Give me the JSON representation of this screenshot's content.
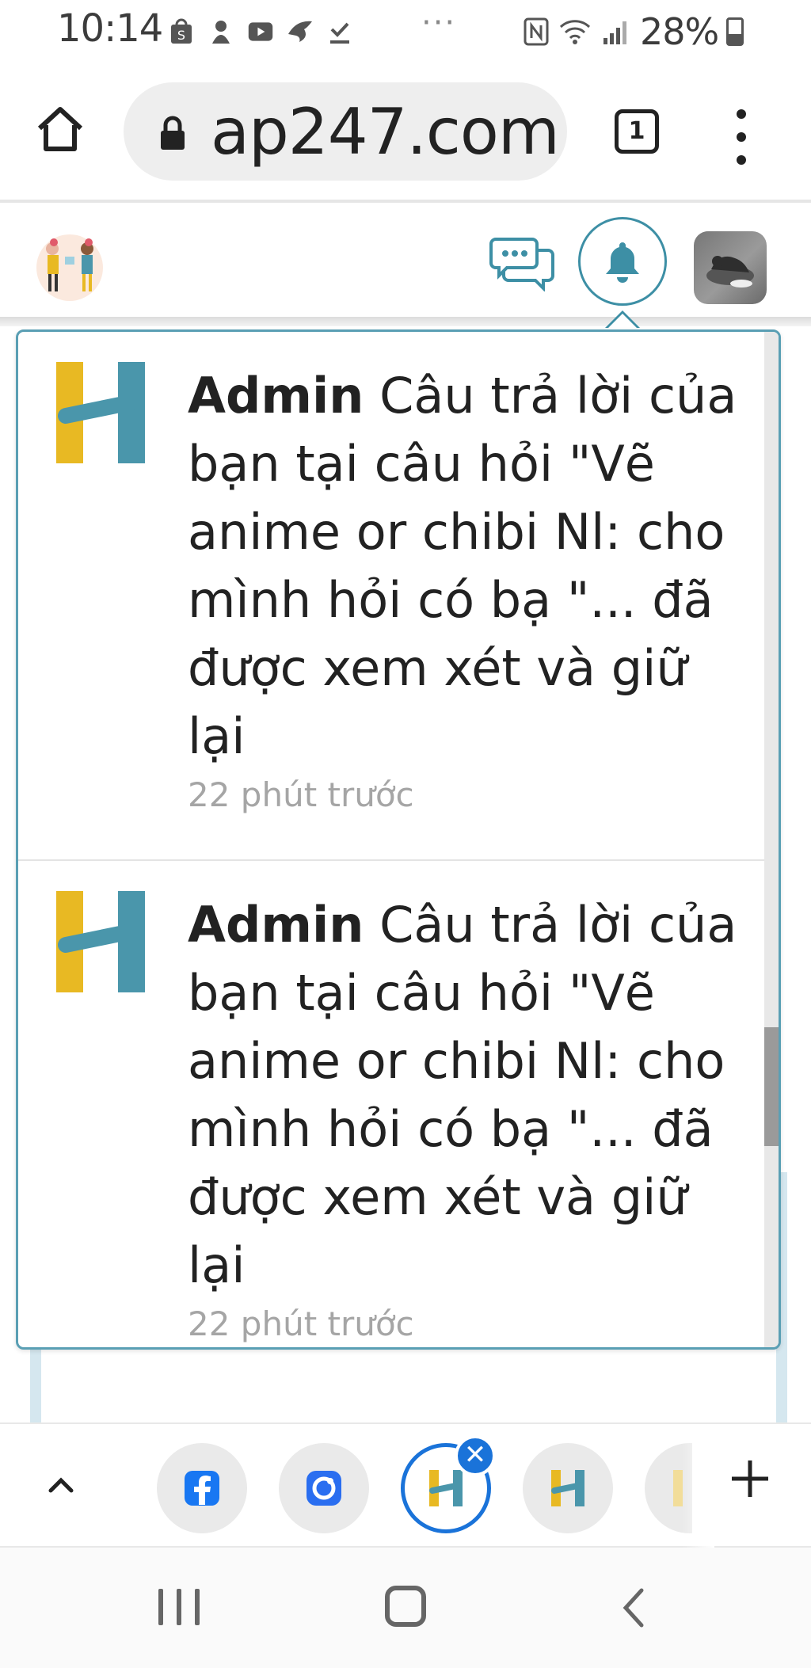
{
  "status_bar": {
    "time": "10:14",
    "battery": "28%",
    "overflow": "···"
  },
  "browser": {
    "url": "ap247.com",
    "tab_count": "1"
  },
  "notifications": [
    {
      "sender": "Admin",
      "message": "Câu trả lời của bạn tại câu hỏi \"Vẽ anime or chibi Nl: cho mình hỏi có bạ \"... đã được xem xét và giữ lại",
      "time": "22 phút trước"
    },
    {
      "sender": "Admin",
      "message": "Câu trả lời của bạn tại câu hỏi \"Vẽ anime or chibi Nl: cho mình hỏi có bạ \"... đã được xem xét và giữ lại",
      "time": "22 phút trước"
    }
  ],
  "tab_strip": {
    "close_symbol": "✕"
  },
  "colors": {
    "accent": "#3d8fa5",
    "tab_active": "#1a73d9",
    "logo_yellow": "#e8b923",
    "logo_teal": "#4a96ab"
  }
}
